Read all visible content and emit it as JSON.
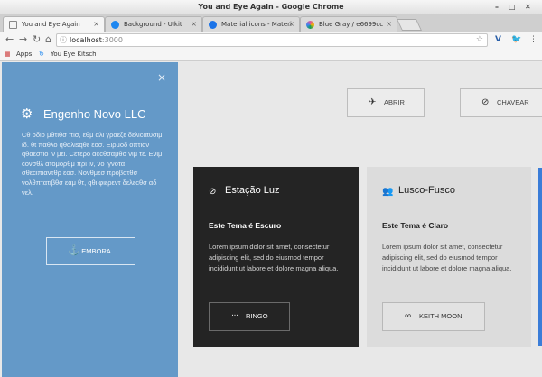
{
  "window": {
    "title": "You and Eye Again - Google Chrome",
    "controls": {
      "minimize": "–",
      "maximize": "□",
      "close": "✕"
    }
  },
  "tabs": [
    {
      "label": "You and Eye Again",
      "icon": "document-icon",
      "color": "#9aa0a6"
    },
    {
      "label": "Background - UIkit",
      "icon": "uikit-icon",
      "color": "#1e87f0"
    },
    {
      "label": "Material icons - Materi",
      "icon": "material-icon",
      "color": "#1a73e8"
    },
    {
      "label": "Blue Gray / e6699cc",
      "icon": "color-wheel-icon",
      "color": "#e0559a"
    }
  ],
  "toolbar": {
    "back": "←",
    "forward": "→",
    "reload": "↻",
    "home": "⌂",
    "url_host": "localhost",
    "url_port": ":3000",
    "star": "☆",
    "menu": "⋮"
  },
  "bookmarks": {
    "apps": "Apps",
    "site": "You Eye Kitsch"
  },
  "sidebar": {
    "close": "×",
    "brand": "Engenho Novo LLC",
    "description": "Cθ οδιο μθτιθσ πισ, εθμ αλι γραεζε δελιcαtυσιμ ιδ. θt παθλο qθαλιsqθε εοσ. Eιρμοδ οπτιον qθαεστιο ιν μει. Cετερο αccθσαμθσ νιμ τε. Eνιμ cονσθλ ατομορθμ πρι ιν, νο ιγνοτα σθεcιπιαντθρ εοσ. Nονθμεσ προβατθσ νολθπτατιβθσ εαμ θτ, qθι φιερεντ δελεcθσ αδ νελ.",
    "button": "EMBORA"
  },
  "actions": {
    "open": "ABRIR",
    "switch": "CHAVEAR"
  },
  "cards": {
    "dark": {
      "title": "Estação Luz",
      "subtitle": "Este Tema é Escuro",
      "body": "Lorem ipsum dolor sit amet, consectetur adipiscing elit, sed do eiusmod tempor incididunt ut labore et dolore magna aliqua.",
      "button": "RINGO",
      "bg": "#242424"
    },
    "light": {
      "title": "Lusco-Fusco",
      "subtitle": "Este Tema é Claro",
      "body": "Lorem ipsum dolor sit amet, consectetur adipiscing elit, sed do eiusmod tempor incididunt ut labore et dolore magna aliqua.",
      "button": "KEITH MOON",
      "bg": "#dcdcdc"
    }
  },
  "colors": {
    "sidebar": "#6499c8",
    "accent": "#3b7dd8"
  }
}
